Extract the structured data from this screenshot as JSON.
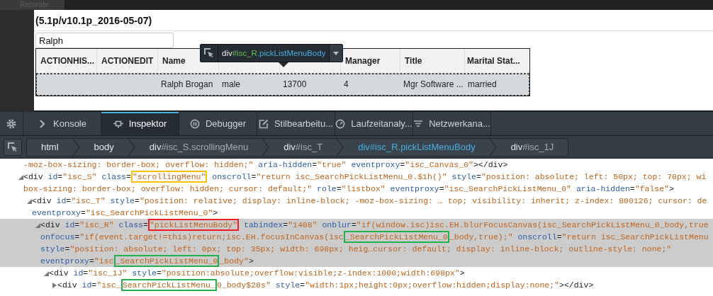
{
  "top_bar": {
    "tab": "Recreate"
  },
  "app": {
    "title": "(5.1p/v10.1p_2016-05-07)",
    "search": {
      "value": "Ralph"
    },
    "grid": {
      "columns": [
        "ACTIONHIS...",
        "ACTIONEDIT",
        "Name",
        null,
        null,
        "Manager",
        "Title",
        "Marital Stat..."
      ],
      "rows": [
        {
          "selected": true,
          "cells": [
            null,
            null,
            "Ralph Brogan",
            "male",
            "13700",
            "4",
            "Mgr Software ...",
            "married"
          ]
        }
      ]
    },
    "tooltip": {
      "tag": "div",
      "id": "#isc_R",
      "classes": ".pickListMenuBody"
    }
  },
  "devtools": {
    "tabs": [
      {
        "kind": "console",
        "label": "Konsole",
        "selected": false
      },
      {
        "kind": "inspector",
        "label": "Inspektor",
        "selected": true
      },
      {
        "kind": "debugger",
        "label": "Debugger",
        "selected": false
      },
      {
        "kind": "style-editor",
        "label": "Stilbearbeitu...",
        "selected": false
      },
      {
        "kind": "performance",
        "label": "Laufzeitanaly...",
        "selected": false
      },
      {
        "kind": "network",
        "label": "Netzwerkana...",
        "selected": false
      }
    ],
    "breadcrumbs": [
      {
        "tag": "html",
        "selected": false
      },
      {
        "tag": "body",
        "selected": false
      },
      {
        "tag": "div",
        "selector": "#isc_S.scrollingMenu",
        "selected": false
      },
      {
        "tag": "div",
        "selector": "#isc_T",
        "selected": false
      },
      {
        "tag": "div",
        "selector": "#isc_R.pickListMenuBody",
        "selected": true
      },
      {
        "tag": "div",
        "selector": "#isc_1J",
        "selected": false
      }
    ],
    "markup": [
      {
        "kind": "tail",
        "selected": false,
        "lines": [
          [
            {
              "text": "-moz-box-sizing: border-box; overflow: hidden;\" aria-hidden=\"true\" eventproxy=\"isc_Canvas_0\"></div>"
            }
          ]
        ]
      },
      {
        "kind": "element",
        "expanded": true,
        "selected": false,
        "lines": [
          [
            {
              "text": "<div id=\"isc_S\" class="
            },
            {
              "text": "\"scrollingMenu\"",
              "color": "#ffc000"
            },
            {
              "text": " onscroll=\"return isc_SearchPickListMenu_0.$1h()\" style=\"position: absolute; left: 50px; top: 70px; wi"
            }
          ],
          [
            {
              "text": "box-sizing: border-box; overflow: hidden; cursor: default;\" role=\"listbox\" eventproxy=\"isc_SearchPickListMenu_0\" aria-hidden=\"false\">"
            }
          ]
        ],
        "children": [
          {
            "kind": "element",
            "expanded": true,
            "selected": false,
            "lines": [
              [
                {
                  "text": "<div id=\"isc_T\" style=\"position: relative; display: inline-block; -moz-box-sizing: … top; visibility: inherit; z-index: 800126; cursor: de"
                }
              ],
              [
                {
                  "text": "eventproxy=\"isc_SearchPickListMenu_0\">"
                }
              ]
            ],
            "children": [
              {
                "kind": "element",
                "expanded": true,
                "selected": true,
                "lines": [
                  [
                    {
                      "text": "<div id=\"isc_R\" class="
                    },
                    {
                      "text": "\"pickListMenuBody\"",
                      "color": "#ee1c25"
                    },
                    {
                      "text": " tabindex=\"1408\" onblur=\"if(window.isc)isc.EH.blurFocusCanvas(isc_SearchPickListMenu_0_body,true"
                    }
                  ],
                  [
                    {
                      "text": "onfocus=\"if(event.target!=this)return;isc.EH.focusInCanvas(isc"
                    },
                    {
                      "text": "_SearchPickListMenu_0",
                      "color": "#22b14c"
                    },
                    {
                      "text": "_body,true);\" onscroll=\"return isc_SearchPickListMenu"
                    }
                  ],
                  [
                    {
                      "text": "style=\"position: absolute; left: 0px; top: 35px; width: 698px; heig…cursor: default; display: inline-block; outline-style: none;\""
                    }
                  ],
                  [
                    {
                      "text": "eventproxy=\"isc"
                    },
                    {
                      "text": "_SearchPickListMenu_0",
                      "color": "#22b14c"
                    },
                    {
                      "text": "_body\">"
                    }
                  ]
                ],
                "children": [
                  {
                    "kind": "element",
                    "expanded": true,
                    "selected": false,
                    "lines": [
                      [
                        {
                          "text": "<div id=\"isc_1J\" style=\"position:absolute;overflow:visible;z-index:1000;width:698px\">"
                        }
                      ]
                    ],
                    "children": [
                      {
                        "kind": "element",
                        "expanded": false,
                        "selected": false,
                        "lines": [
                          [
                            {
                              "text": "<div id=\"isc_"
                            },
                            {
                              "text": "SearchPickListMenu_",
                              "color": "#22b14c"
                            },
                            {
                              "text": "0_body$28s\" style=\"width:1px;height:0px;overflow:hidden;display:none;\"></div>"
                            }
                          ]
                        ]
                      }
                    ]
                  }
                ]
              }
            ]
          }
        ]
      }
    ]
  }
}
